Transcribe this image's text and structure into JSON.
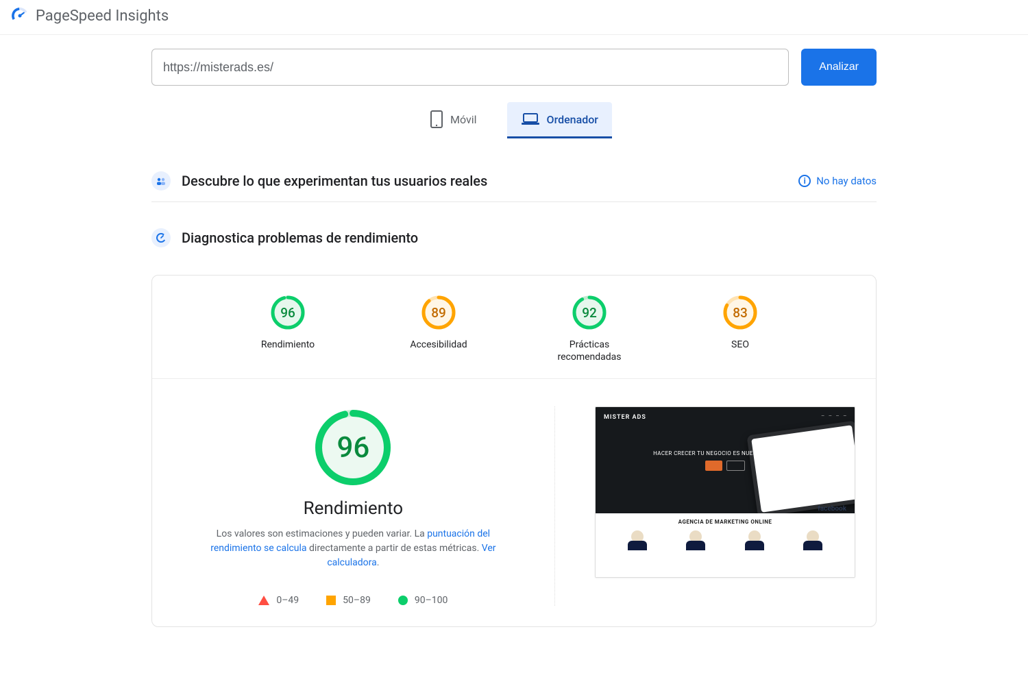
{
  "app": {
    "title": "PageSpeed Insights"
  },
  "search": {
    "url_value": "https://misterads.es/",
    "analyze_label": "Analizar"
  },
  "tabs": {
    "mobile_label": "Móvil",
    "desktop_label": "Ordenador"
  },
  "sections": {
    "real_users": "Descubre lo que experimentan tus usuarios reales",
    "no_data": "No hay datos",
    "diagnose": "Diagnostica problemas de rendimiento"
  },
  "scores": {
    "performance": {
      "value": "96",
      "label": "Rendimiento"
    },
    "accessibility": {
      "value": "89",
      "label": "Accesibilidad"
    },
    "best_practices": {
      "value": "92",
      "label": "Prácticas recomendadas"
    },
    "seo": {
      "value": "83",
      "label": "SEO"
    }
  },
  "big": {
    "score": "96",
    "title": "Rendimiento",
    "desc_prefix": "Los valores son estimaciones y pueden variar. La ",
    "desc_link1": "puntuación del rendimiento se calcula",
    "desc_mid": " directamente a partir de estas métricas. ",
    "desc_link2": "Ver calculadora",
    "desc_suffix": "."
  },
  "legend": {
    "low": "0–49",
    "mid": "50–89",
    "high": "90–100"
  },
  "screenshot": {
    "brand": "MISTER ADS",
    "headline": "HACER CRECER TU NEGOCIO ES NUESTRO OBJETIVO",
    "subtitle": "AGENCIA DE MARKETING ONLINE",
    "fb": "facebook"
  }
}
